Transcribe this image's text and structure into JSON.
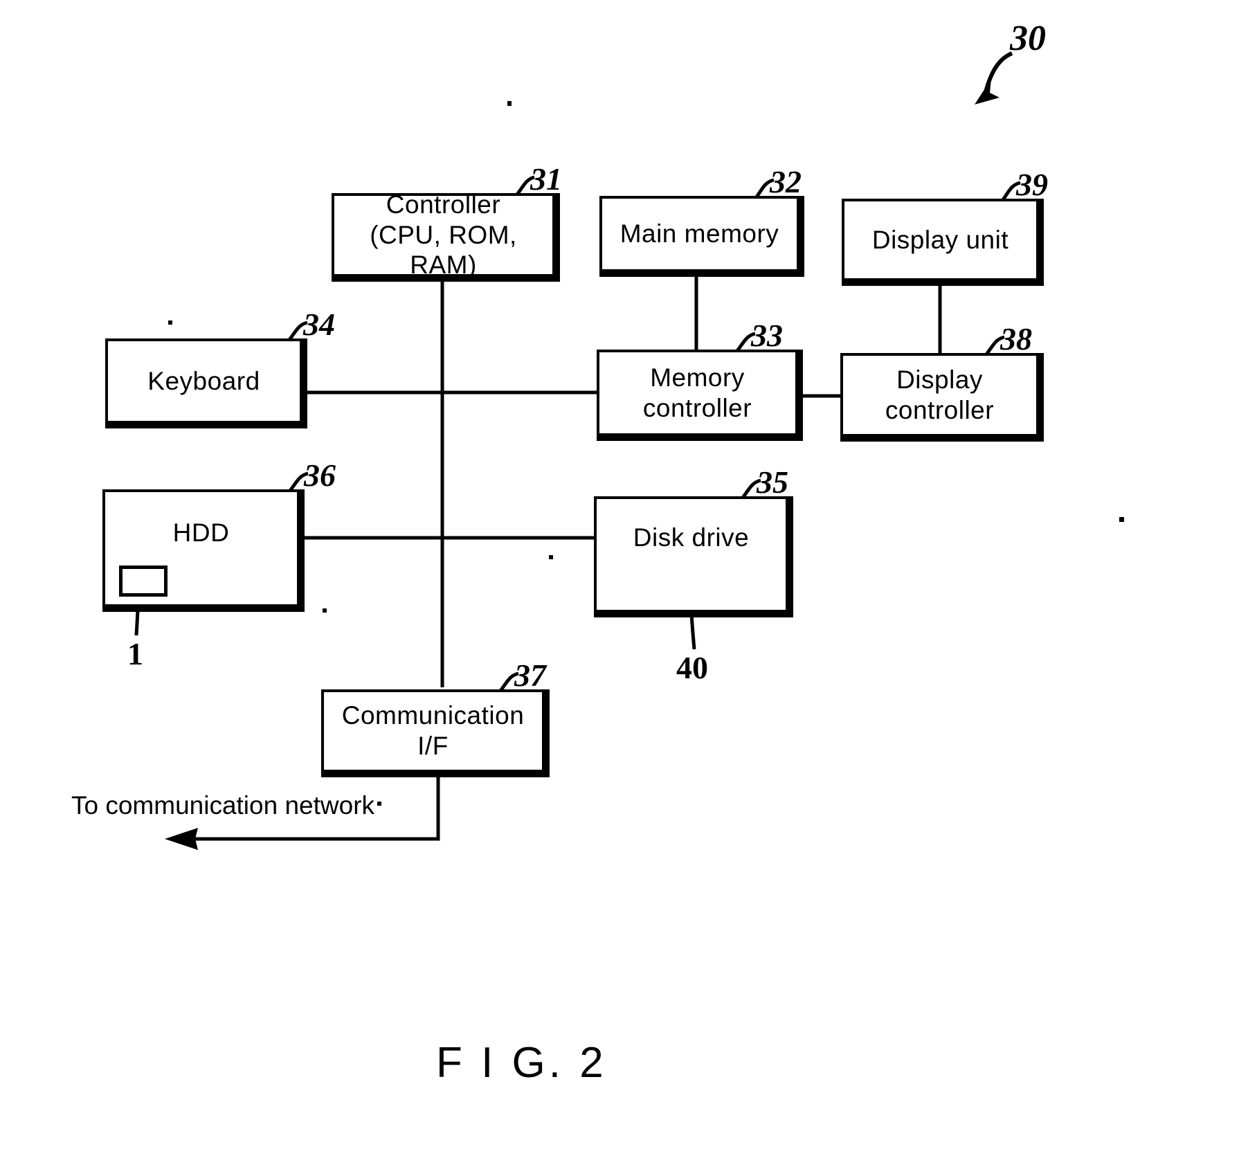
{
  "figure": {
    "caption": "F I G. 2",
    "system_ref": "30",
    "network_text": "To communication network"
  },
  "blocks": [
    {
      "id": "controller",
      "label": "Controller\n(CPU, ROM, RAM)",
      "ref": "31"
    },
    {
      "id": "main-memory",
      "label": "Main memory",
      "ref": "32"
    },
    {
      "id": "display-unit",
      "label": "Display unit",
      "ref": "39"
    },
    {
      "id": "keyboard",
      "label": "Keyboard",
      "ref": "34"
    },
    {
      "id": "memory-controller",
      "label": "Memory controller",
      "ref": "33"
    },
    {
      "id": "display-controller",
      "label": "Display controller",
      "ref": "38"
    },
    {
      "id": "hdd",
      "label": "HDD",
      "ref": "36"
    },
    {
      "id": "disk-drive",
      "label": "Disk drive",
      "ref": "35"
    },
    {
      "id": "communication-if",
      "label": "Communication I/F",
      "ref": "37"
    }
  ],
  "sub_parts": [
    {
      "id": "hdd-program-area",
      "ref": "1",
      "parent": "hdd"
    },
    {
      "id": "optical-disk",
      "ref": "40",
      "parent": "disk-drive"
    }
  ],
  "colors": {
    "line": "#000000",
    "background": "#ffffff"
  }
}
